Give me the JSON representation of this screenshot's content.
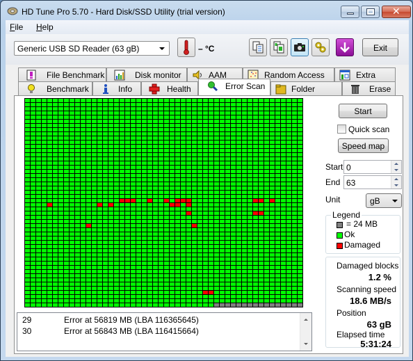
{
  "window": {
    "title": "HD Tune Pro 5.70 - Hard Disk/SSD Utility (trial version)"
  },
  "menu": {
    "file_label": "File",
    "help_label": "Help"
  },
  "toolbar": {
    "drive_selected": "Generic USB SD Reader (63 gB)",
    "temperature": "– °C",
    "exit_label": "Exit",
    "icons": [
      "copy-text-icon",
      "copy-screenshot-icon",
      "camera-icon",
      "options-icon",
      "save-down-icon"
    ]
  },
  "tabs": {
    "row_top": [
      "File Benchmark",
      "Disk monitor",
      "AAM",
      "Random Access",
      "Extra tests"
    ],
    "row_bottom": [
      "Benchmark",
      "Info",
      "Health",
      "Error Scan",
      "Folder Usage",
      "Erase"
    ],
    "selected": "Error Scan"
  },
  "controls": {
    "start_label": "Start",
    "quick_scan_label": "Quick scan",
    "quick_scan_checked": false,
    "speed_map_label": "Speed map",
    "start_field_label": "Start",
    "start_value": "0",
    "end_field_label": "End",
    "end_value": "63",
    "unit_label": "Unit",
    "unit_value": "gB"
  },
  "legend": {
    "title": "Legend",
    "items": [
      {
        "label": "= 24 MB",
        "color": "#808080"
      },
      {
        "label": "Ok",
        "color": "#00ff00"
      },
      {
        "label": "Damaged",
        "color": "#ff0000"
      }
    ]
  },
  "stats": {
    "damaged_blocks_label": "Damaged blocks",
    "damaged_blocks_value": "1.2 %",
    "scanning_speed_label": "Scanning speed",
    "scanning_speed_value": "18.6 MB/s",
    "position_label": "Position",
    "position_value": "63 gB",
    "elapsed_time_label": "Elapsed time",
    "elapsed_time_value": "5:31:24"
  },
  "error_log": [
    {
      "num": "29",
      "message": "Error at 56819 MB (LBA 116365645)"
    },
    {
      "num": "30",
      "message": "Error at 56843 MB (LBA 116415664)"
    }
  ],
  "scan_map": {
    "columns": 50,
    "rows": 50,
    "ok_color": "#00ff00",
    "damaged_color": "#ff0000",
    "unscanned_color": "#808080",
    "last_row_ok_columns": 34,
    "damaged_cells": [
      [
        24,
        17
      ],
      [
        24,
        18
      ],
      [
        24,
        19
      ],
      [
        24,
        22
      ],
      [
        24,
        25
      ],
      [
        24,
        27
      ],
      [
        24,
        28
      ],
      [
        24,
        29
      ],
      [
        24,
        41
      ],
      [
        24,
        42
      ],
      [
        24,
        44
      ],
      [
        25,
        4
      ],
      [
        25,
        13
      ],
      [
        25,
        15
      ],
      [
        25,
        26
      ],
      [
        25,
        27
      ],
      [
        25,
        29
      ],
      [
        27,
        29
      ],
      [
        27,
        41
      ],
      [
        27,
        42
      ],
      [
        30,
        11
      ],
      [
        30,
        30
      ],
      [
        46,
        32
      ],
      [
        46,
        33
      ]
    ]
  }
}
